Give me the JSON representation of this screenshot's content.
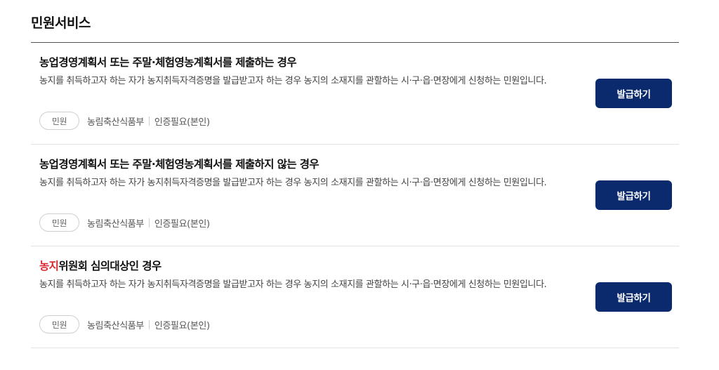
{
  "section": {
    "title": "민원서비스"
  },
  "items": [
    {
      "title": "농업경영계획서 또는 주말·체험영농계획서를 제출하는 경우",
      "title_highlight": "",
      "title_rest": "",
      "description": "농지를 취득하고자 하는 자가 농지취득자격증명을 발급받고자 하는 경우 농지의 소재지를 관할하는 시·구·읍·면장에게 신청하는 민원입니다.",
      "tag": "민원",
      "org": "농림축산식품부",
      "auth": "인증필요(본인)",
      "button": "발급하기"
    },
    {
      "title": "농업경영계획서 또는 주말·체험영농계획서를 제출하지 않는 경우",
      "title_highlight": "",
      "title_rest": "",
      "description": "농지를 취득하고자 하는 자가 농지취득자격증명을 발급받고자 하는 경우 농지의 소재지를 관할하는 시·구·읍·면장에게 신청하는 민원입니다.",
      "tag": "민원",
      "org": "농림축산식품부",
      "auth": "인증필요(본인)",
      "button": "발급하기"
    },
    {
      "title": "",
      "title_highlight": "농지",
      "title_rest": "위원회 심의대상인 경우",
      "description": "농지를 취득하고자 하는 자가 농지취득자격증명을 발급받고자 하는 경우 농지의 소재지를 관할하는 시·구·읍·면장에게 신청하는 민원입니다.",
      "tag": "민원",
      "org": "농림축산식품부",
      "auth": "인증필요(본인)",
      "button": "발급하기"
    }
  ],
  "colors": {
    "button_bg": "#0b2a6e",
    "highlight": "#d8262f"
  }
}
